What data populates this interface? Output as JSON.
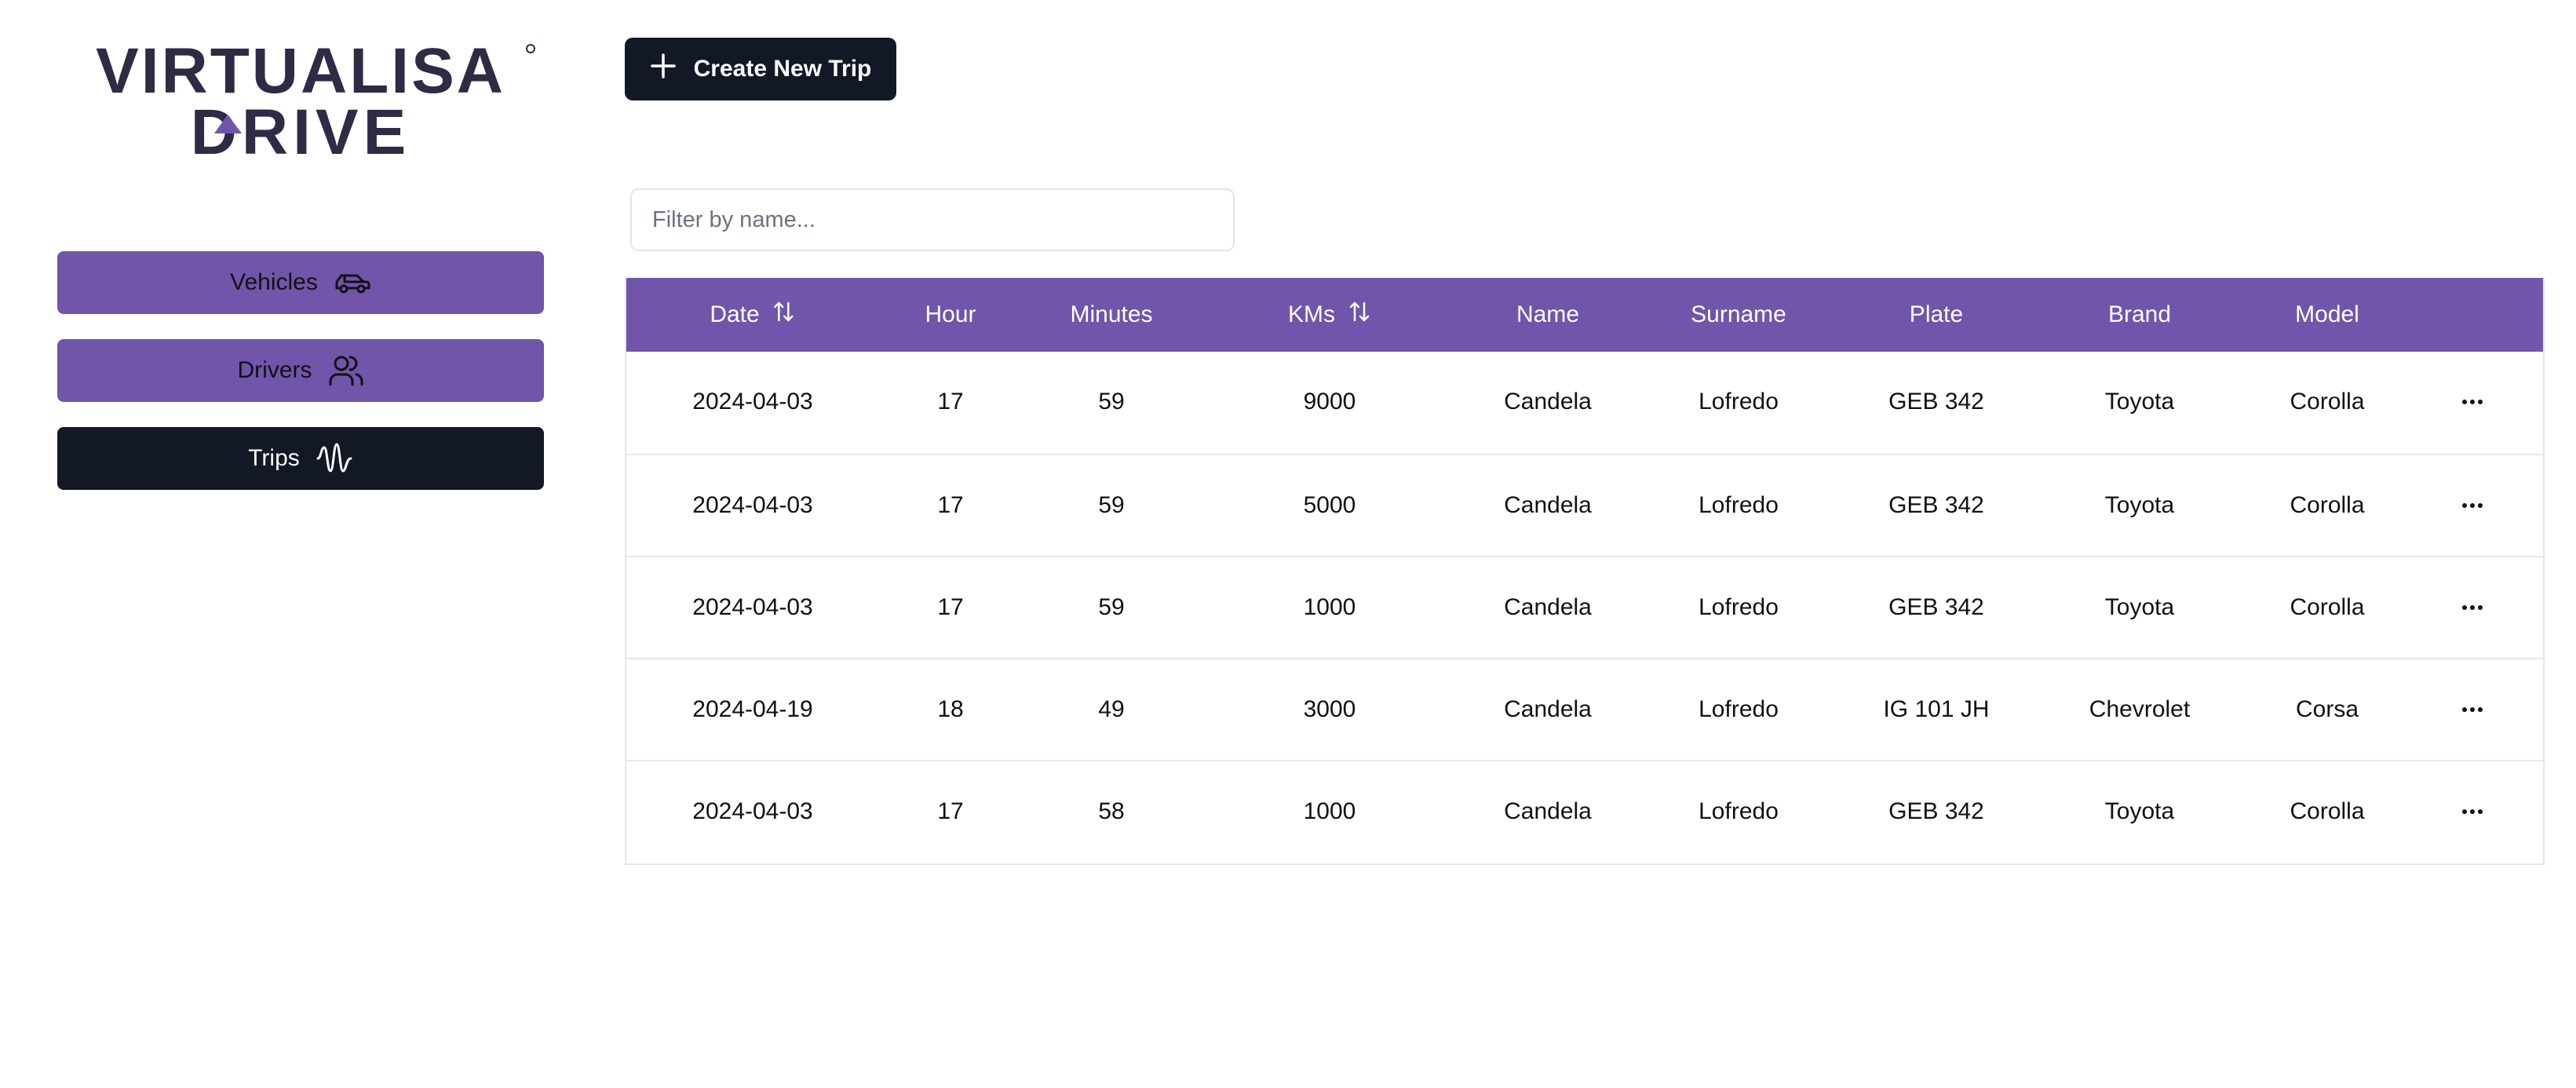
{
  "brand": {
    "logo_line1": "VIRTUALISA",
    "logo_line2": "DRIVE",
    "primary_color": "#7055aa",
    "dark_color": "#121826",
    "text_color": "#2e2b45"
  },
  "sidebar": {
    "items": [
      {
        "label": "Vehicles",
        "icon": "car-icon",
        "active": false
      },
      {
        "label": "Drivers",
        "icon": "users-icon",
        "active": false
      },
      {
        "label": "Trips",
        "icon": "wave-icon",
        "active": true
      }
    ]
  },
  "toolbar": {
    "create_label": "Create New Trip",
    "create_icon": "plus-icon"
  },
  "filter": {
    "placeholder": "Filter by name...",
    "value": ""
  },
  "table": {
    "columns": [
      {
        "key": "date",
        "label": "Date",
        "sortable": true
      },
      {
        "key": "hour",
        "label": "Hour",
        "sortable": false
      },
      {
        "key": "minutes",
        "label": "Minutes",
        "sortable": false
      },
      {
        "key": "kms",
        "label": "KMs",
        "sortable": true
      },
      {
        "key": "name",
        "label": "Name",
        "sortable": false
      },
      {
        "key": "surname",
        "label": "Surname",
        "sortable": false
      },
      {
        "key": "plate",
        "label": "Plate",
        "sortable": false
      },
      {
        "key": "brand",
        "label": "Brand",
        "sortable": false
      },
      {
        "key": "model",
        "label": "Model",
        "sortable": false
      }
    ],
    "rows": [
      {
        "date": "2024-04-03",
        "hour": "17",
        "minutes": "59",
        "kms": "9000",
        "name": "Candela",
        "surname": "Lofredo",
        "plate": "GEB 342",
        "brand": "Toyota",
        "model": "Corolla"
      },
      {
        "date": "2024-04-03",
        "hour": "17",
        "minutes": "59",
        "kms": "5000",
        "name": "Candela",
        "surname": "Lofredo",
        "plate": "GEB 342",
        "brand": "Toyota",
        "model": "Corolla"
      },
      {
        "date": "2024-04-03",
        "hour": "17",
        "minutes": "59",
        "kms": "1000",
        "name": "Candela",
        "surname": "Lofredo",
        "plate": "GEB 342",
        "brand": "Toyota",
        "model": "Corolla"
      },
      {
        "date": "2024-04-19",
        "hour": "18",
        "minutes": "49",
        "kms": "3000",
        "name": "Candela",
        "surname": "Lofredo",
        "plate": "IG 101 JH",
        "brand": "Chevrolet",
        "model": "Corsa"
      },
      {
        "date": "2024-04-03",
        "hour": "17",
        "minutes": "58",
        "kms": "1000",
        "name": "Candela",
        "surname": "Lofredo",
        "plate": "GEB 342",
        "brand": "Toyota",
        "model": "Corolla"
      }
    ],
    "row_action_icon": "more-horizontal-icon"
  }
}
